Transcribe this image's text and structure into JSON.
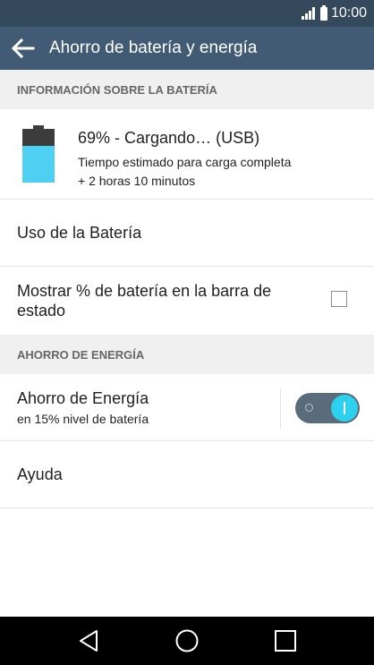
{
  "status_bar": {
    "time": "10:00"
  },
  "app_bar": {
    "title": "Ahorro de batería y energía"
  },
  "battery_section": {
    "header": "INFORMACIÓN SOBRE LA BATERÍA",
    "status": "69% - Cargando… (USB)",
    "estimate_label": "Tiempo estimado para carga completa",
    "estimate_value": "+ 2 horas 10 minutos",
    "level_percent": 69,
    "fill_color": "#4dd0f1"
  },
  "rows": {
    "battery_use": "Uso de la Batería",
    "show_percent": "Mostrar % de batería en la barra de estado",
    "show_percent_checked": false
  },
  "energy_section": {
    "header": "AHORRO DE ENERGÍA",
    "saver_title": "Ahorro de Energía",
    "saver_sub": "en 15% nivel de batería",
    "saver_enabled": true,
    "help": "Ayuda"
  },
  "colors": {
    "status_bar": "#34495c",
    "app_bar": "#425b74",
    "accent": "#2ed0ef"
  }
}
